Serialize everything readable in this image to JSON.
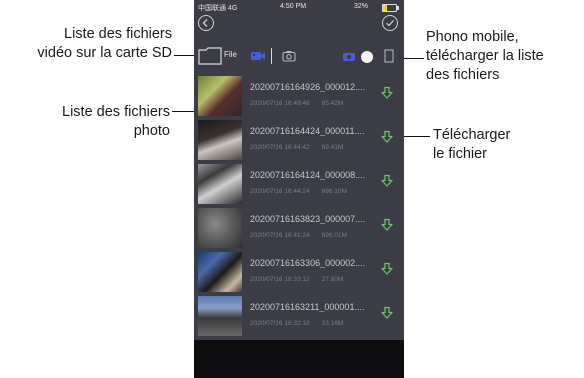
{
  "annotations": {
    "video_list": [
      "Liste des fichiers",
      "vidéo sur la carte SD"
    ],
    "photo_list": [
      "Liste des fichiers",
      "photo"
    ],
    "phone_mobile": [
      "Phono mobile,",
      "télécharger la liste",
      "des fichiers"
    ],
    "download_file": [
      "Télécharger",
      "le fichier"
    ]
  },
  "status_bar": {
    "carrier": "中国联通 4G",
    "time": "4:50 PM",
    "battery": "32%"
  },
  "toolbar": {
    "file_label": "File"
  },
  "files": [
    {
      "name": "20200716164926_000012....",
      "date": "2020/07/16 16:49:46",
      "size": "85.42M"
    },
    {
      "name": "20200716164424_000011....",
      "date": "2020/07/16 16:44:42",
      "size": "69.41M"
    },
    {
      "name": "20200716164124_000008....",
      "date": "2020/07/16 16:44:24",
      "size": "696.10M"
    },
    {
      "name": "20200716163823_000007....",
      "date": "2020/07/16 16:41:24",
      "size": "696.01M"
    },
    {
      "name": "20200716163306_000002....",
      "date": "2020/07/16 16:33:12",
      "size": "27.80M"
    },
    {
      "name": "20200716163211_000001....",
      "date": "2020/07/16 16:32:18",
      "size": "33.16M"
    }
  ],
  "colors": {
    "accent": "#4b5bd8",
    "download_arrow": "#67c96c",
    "background": "#3c3c46"
  },
  "icons": {
    "back": "back-chevron-icon",
    "confirm": "checkmark-icon",
    "folder": "folder-icon",
    "video": "video-camera-icon",
    "photo": "camera-icon",
    "phone": "phone-camera-icon",
    "sd_card": "sd-card-icon",
    "download": "download-arrow-icon"
  }
}
